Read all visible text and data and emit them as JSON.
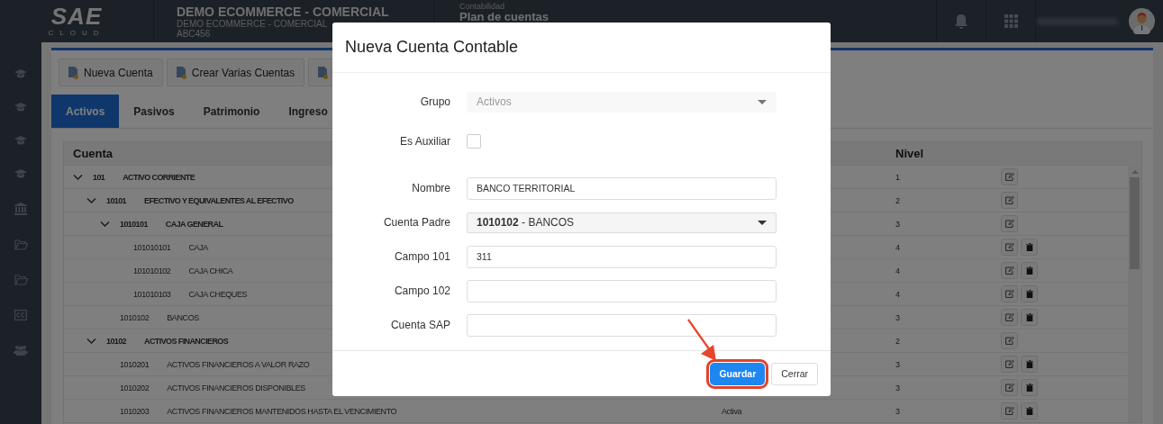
{
  "header": {
    "logo_text": "SAE",
    "logo_sub": "CLOUD",
    "company": {
      "title": "DEMO ECOMMERCE - COMERCIAL",
      "subtitle": "DEMO ECOMMERCE - COMERCIAL",
      "code": "ABC456"
    },
    "module": {
      "section": "Contabilidad",
      "title": "Plan de cuentas"
    }
  },
  "toolbar": [
    {
      "kind": "label",
      "label": "Nueva Cuenta"
    },
    {
      "kind": "label",
      "label": "Crear Varias Cuentas"
    },
    {
      "kind": "blurred"
    }
  ],
  "tabs": [
    {
      "label": "Activos",
      "selected": true
    },
    {
      "label": "Pasivos",
      "selected": false
    },
    {
      "label": "Patrimonio",
      "selected": false
    },
    {
      "label": "Ingreso",
      "selected": false
    }
  ],
  "table": {
    "columns": [
      {
        "label": "Cuenta"
      },
      {
        "label": "Nivel"
      }
    ],
    "rows": [
      {
        "code": "101",
        "name": "ACTIVO CORRIENTE",
        "level": "1",
        "expanded": true,
        "deletable": false,
        "children": [
          {
            "code": "10101",
            "name": "EFECTIVO Y EQUIVALENTES AL EFECTIVO",
            "level": "2",
            "expanded": true,
            "deletable": false,
            "children": [
              {
                "code": "1010101",
                "name": "CAJA GENERAL",
                "level": "3",
                "expanded": true,
                "deletable": false,
                "children": [
                  {
                    "code": "101010101",
                    "name": "CAJA",
                    "level": "4",
                    "deletable": true
                  },
                  {
                    "code": "101010102",
                    "name": "CAJA CHICA",
                    "level": "4",
                    "deletable": true
                  },
                  {
                    "code": "101010103",
                    "name": "CAJA CHEQUES",
                    "level": "4",
                    "deletable": true
                  }
                ]
              },
              {
                "code": "1010102",
                "name": "BANCOS",
                "level": "3",
                "deletable": true
              }
            ]
          },
          {
            "code": "10102",
            "name": "ACTIVOS FINANCIEROS",
            "level": "2",
            "expanded": true,
            "deletable": false,
            "children": [
              {
                "code": "1010201",
                "name": "ACTIVOS FINANCIEROS A VALOR RAZO",
                "level": "3",
                "deletable": true
              },
              {
                "code": "1010202",
                "name": "ACTIVOS FINANCIEROS DISPONIBLES",
                "level": "3",
                "deletable": true
              },
              {
                "code": "1010203",
                "name": "ACTIVOS FINANCIEROS MANTENIDOS HASTA EL VENCIMIENTO",
                "status": "Activa",
                "level": "3",
                "deletable": true
              }
            ]
          }
        ]
      }
    ]
  },
  "modal": {
    "title": "Nueva Cuenta Contable",
    "fields": [
      {
        "kind": "select",
        "label": "Grupo",
        "value": "Activos",
        "disabled": true
      },
      {
        "kind": "checkbox",
        "label": "Es Auxiliar",
        "checked": false
      },
      {
        "kind": "text",
        "label": "Nombre",
        "value": "BANCO TERRITORIAL"
      },
      {
        "kind": "select",
        "label": "Cuenta Padre",
        "value": "**1010102** - BANCOS",
        "disabled": false
      },
      {
        "kind": "text",
        "label": "Campo 101",
        "value": "311"
      },
      {
        "kind": "text",
        "label": "Campo 102"
      },
      {
        "kind": "text",
        "label": "Cuenta SAP"
      }
    ],
    "buttons": [
      {
        "kind": "primary",
        "label": "Guardar",
        "highlighted": true
      },
      {
        "kind": "default",
        "label": "Cerrar",
        "highlighted": false
      }
    ]
  }
}
